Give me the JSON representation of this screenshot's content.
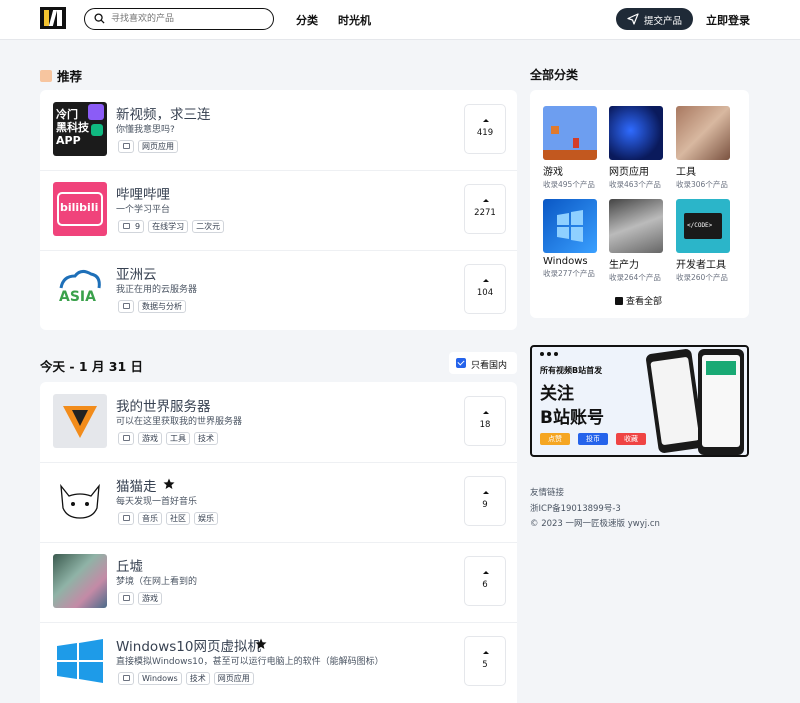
{
  "header": {
    "search_placeholder": "寻找喜欢的产品",
    "nav": [
      "分类",
      "时光机"
    ],
    "submit_label": "提交产品",
    "login_label": "立即登录"
  },
  "recommend": {
    "title": "推荐",
    "items": [
      {
        "title": "新视频，求三连",
        "desc": "你懂我意思吗?",
        "tags": [
          "网页应用"
        ],
        "comments": "",
        "votes": "419",
        "image_text": "冷门黑科技APP"
      },
      {
        "title": "哔哩哔哩",
        "desc": "一个学习平台",
        "tags": [
          "在线学习",
          "二次元"
        ],
        "comments": "9",
        "votes": "2271",
        "image_text": "bilibili"
      },
      {
        "title": "亚洲云",
        "desc": "我正在用的云服务器",
        "tags": [
          "数据与分析"
        ],
        "comments": "",
        "votes": "104",
        "image_text": "ASIA"
      }
    ]
  },
  "today": {
    "title": "今天 - 1 月 31 日",
    "filter_label": "只看国内",
    "items": [
      {
        "title": "我的世界服务器",
        "desc": "可以在这里获取我的世界服务器",
        "tags": [
          "游戏",
          "工具",
          "技术"
        ],
        "votes": "18",
        "starred": false
      },
      {
        "title": "猫猫走",
        "desc": "每天发现一首好音乐",
        "tags": [
          "音乐",
          "社区",
          "娱乐"
        ],
        "votes": "9",
        "starred": true
      },
      {
        "title": "丘墟",
        "desc": "梦境（在网上看到的",
        "tags": [
          "游戏"
        ],
        "votes": "6",
        "starred": false
      },
      {
        "title": "Windows10网页虚拟机",
        "desc": "直接模拟Windows10，甚至可以运行电脑上的软件（能解码图标）",
        "tags": [
          "Windows",
          "技术",
          "网页应用"
        ],
        "votes": "5",
        "starred": true
      }
    ]
  },
  "categories": {
    "title": "全部分类",
    "items": [
      {
        "name": "游戏",
        "count": "收录495个产品"
      },
      {
        "name": "网页应用",
        "count": "收录463个产品"
      },
      {
        "name": "工具",
        "count": "收录306个产品"
      },
      {
        "name": "Windows",
        "count": "收录277个产品"
      },
      {
        "name": "生产力",
        "count": "收录264个产品"
      },
      {
        "name": "开发者工具",
        "count": "收录260个产品"
      }
    ],
    "view_all": "查看全部"
  },
  "banner": {
    "line1": "所有视频B站首发",
    "line2": "关注",
    "line3": "B站账号",
    "btn1": "点赞",
    "btn2": "投币",
    "btn3": "收藏"
  },
  "footer": {
    "links": "友情链接",
    "icp": "浙ICP备19013899号-3",
    "copyright": "© 2023 一网一匠极速版 ywyj.cn"
  }
}
